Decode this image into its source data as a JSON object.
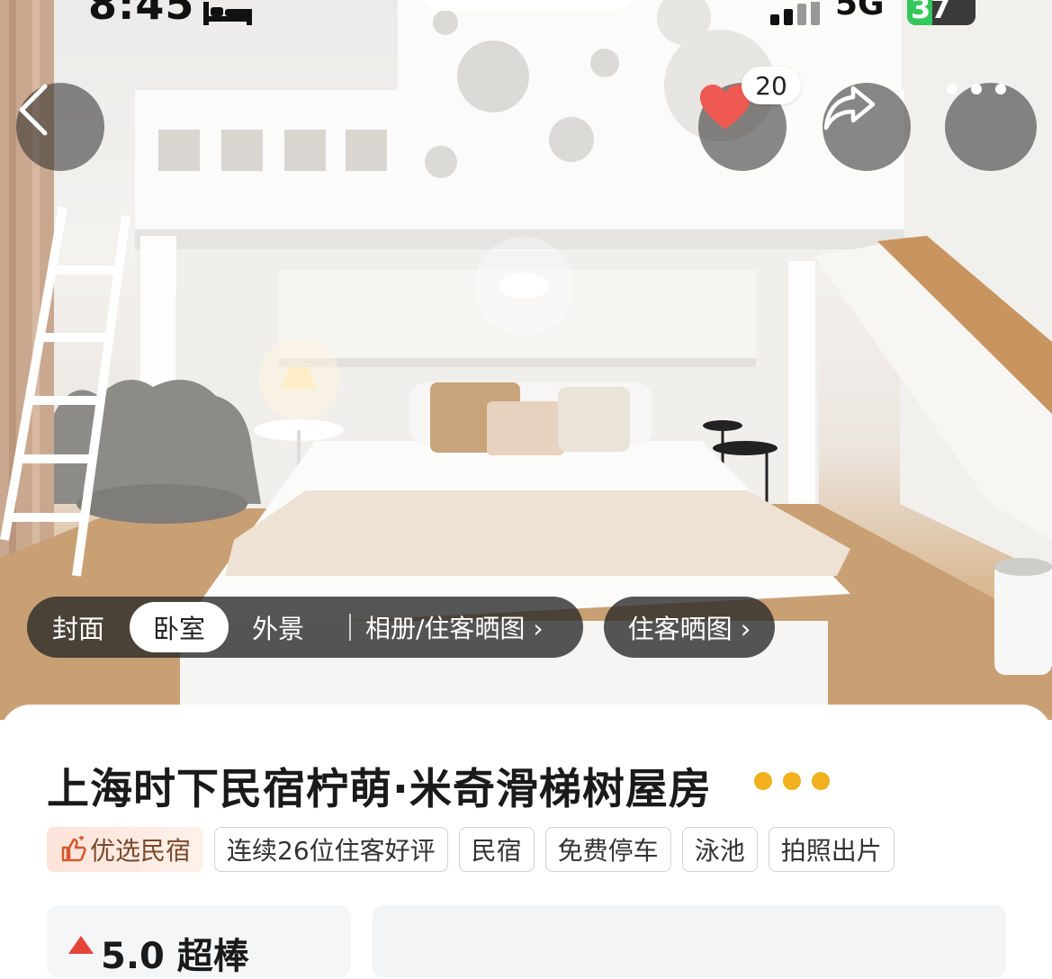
{
  "status_bar": {
    "time": "8:45",
    "network": "5G",
    "battery": "37"
  },
  "hero": {
    "favorite_count": "20"
  },
  "photo_categories": {
    "items": [
      "封面",
      "卧室",
      "外景"
    ],
    "active_index": 1,
    "album_label": "相册/住客晒图 ›",
    "guest_photos_label": "住客晒图 ›"
  },
  "listing": {
    "title": "上海时下民宿柠萌·米奇滑梯树屋房",
    "tags": [
      "优选民宿",
      "连续26位住客好评",
      "民宿",
      "免费停车",
      "泳池",
      "拍照出片"
    ],
    "score_partial": "5.0 超棒"
  },
  "colors": {
    "favorite_heart": "#ee5a52",
    "title_dots": "#f2b01e",
    "battery_fill": "#34c759"
  }
}
